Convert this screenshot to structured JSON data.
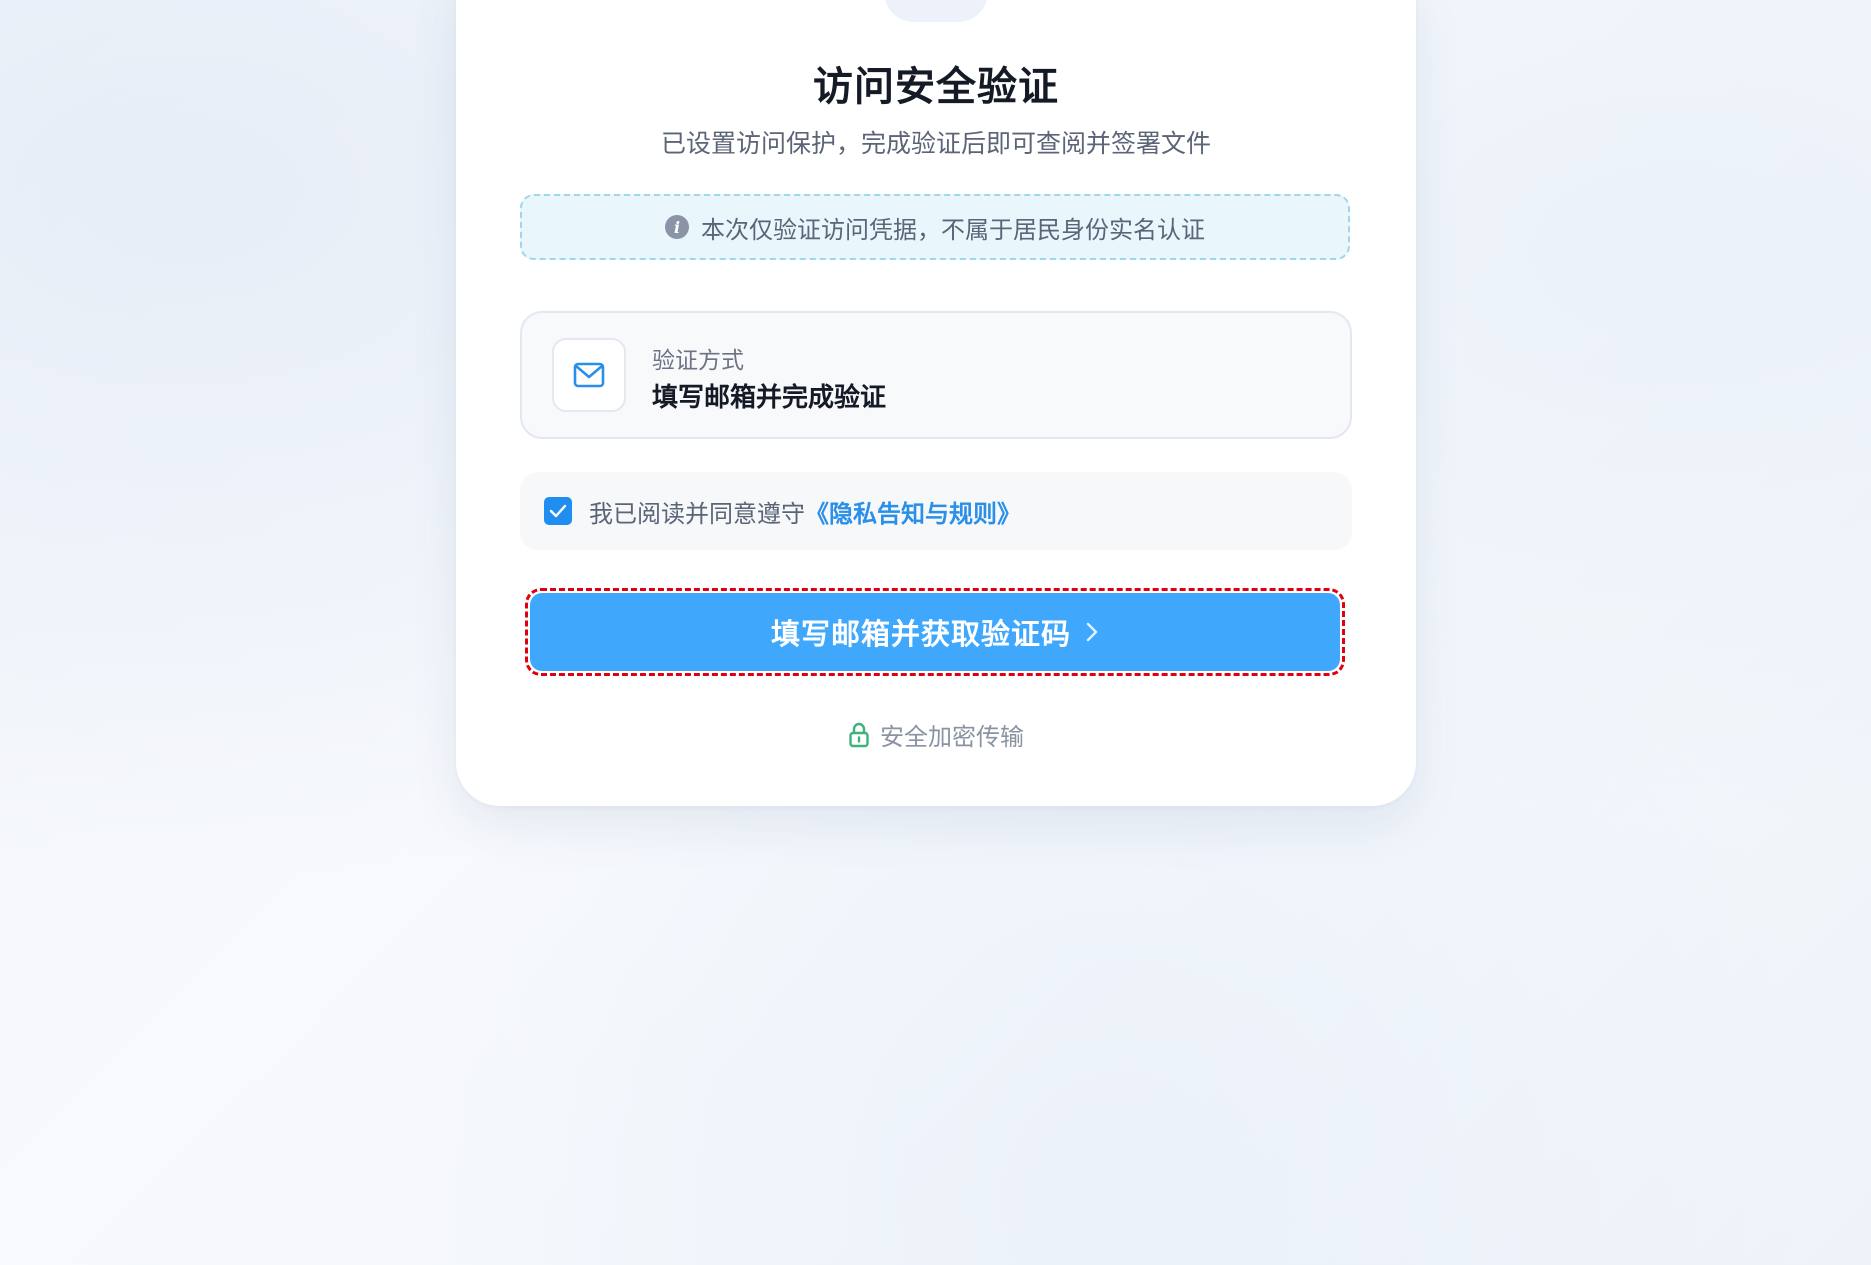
{
  "header": {
    "title": "访问安全验证",
    "subtitle": "已设置访问保护，完成验证后即可查阅并签署文件"
  },
  "notice": {
    "icon": "info-icon",
    "text": "本次仅验证访问凭据，不属于居民身份实名认证"
  },
  "method": {
    "icon": "mail-icon",
    "label": "验证方式",
    "value": "填写邮箱并完成验证"
  },
  "agreement": {
    "checked": true,
    "text": "我已阅读并同意遵守",
    "link_text": "《隐私告知与规则》"
  },
  "primary_button": {
    "label": "填写邮箱并获取验证码",
    "icon": "chevron-right-icon"
  },
  "footer": {
    "icon": "lock-icon",
    "text": "安全加密传输"
  },
  "colors": {
    "primary": "#40a8fc",
    "link": "#2a8fe8",
    "checkbox": "#1f8ef0",
    "highlight_outline": "#e00012",
    "lock": "#3bb37a"
  }
}
